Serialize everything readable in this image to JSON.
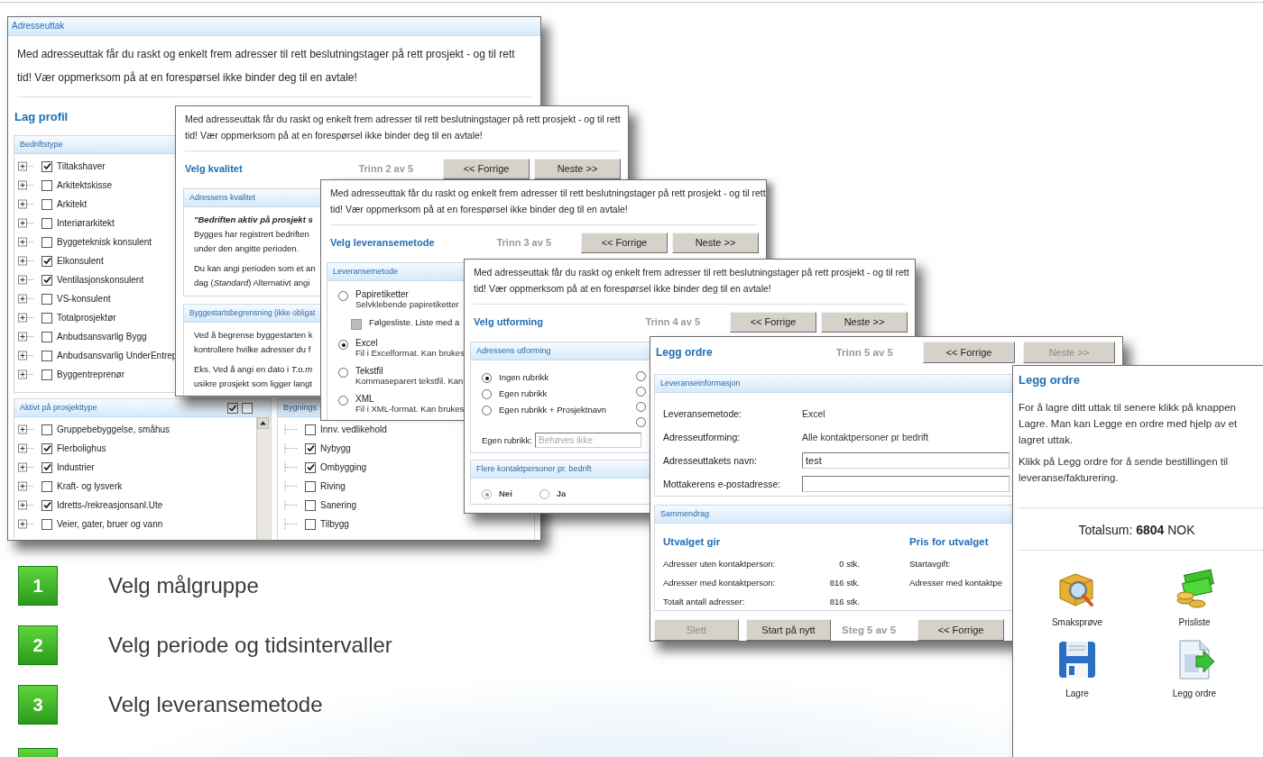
{
  "profile_window": {
    "title": "Adresseuttak",
    "intro": "Med adresseuttak får du raskt og enkelt frem adresser til rett beslutningstager på rett prosjekt - og til rett tid! Vær oppmerksom på at en forespørsel ikke binder deg til en avtale!",
    "heading": "Lag profil",
    "company_types": {
      "title": "Bedriftstype",
      "items": [
        {
          "label": "Tiltakshaver",
          "checked": true
        },
        {
          "label": "Arkitektskisse",
          "checked": false
        },
        {
          "label": "Arkitekt",
          "checked": false
        },
        {
          "label": "Interiørarkitekt",
          "checked": false
        },
        {
          "label": "Byggeteknisk konsulent",
          "checked": false
        },
        {
          "label": "Elkonsulent",
          "checked": true
        },
        {
          "label": "Ventilasjonskonsulent",
          "checked": true
        },
        {
          "label": "VS-konsulent",
          "checked": false
        },
        {
          "label": "Totalprosjektør",
          "checked": false
        },
        {
          "label": "Anbudsansvarlig Bygg",
          "checked": false
        },
        {
          "label": "Anbudsansvarlig UnderEntrep",
          "checked": false
        },
        {
          "label": "Byggentreprenør",
          "checked": false
        }
      ]
    },
    "project_types": {
      "title": "Aktivt på prosjekttype",
      "items": [
        {
          "label": "Gruppebebyggelse, småhus",
          "checked": false
        },
        {
          "label": "Flerbolighus",
          "checked": true
        },
        {
          "label": "Industrier",
          "checked": true
        },
        {
          "label": "Kraft- og lysverk",
          "checked": false
        },
        {
          "label": "Idretts-/rekreasjonsanl.Ute",
          "checked": true
        },
        {
          "label": "Veier, gater, bruer og vann",
          "checked": false
        }
      ]
    },
    "building_types": {
      "title": "Bygnings",
      "items": [
        {
          "label": "Innv. vedlikehold",
          "checked": false
        },
        {
          "label": "Nybygg",
          "checked": true
        },
        {
          "label": "Ombygging",
          "checked": true
        },
        {
          "label": "Riving",
          "checked": false
        },
        {
          "label": "Sanering",
          "checked": false
        },
        {
          "label": "Tilbygg",
          "checked": false
        }
      ]
    }
  },
  "quality_window": {
    "intro": "Med adresseuttak får du raskt og enkelt frem adresser til rett beslutningstager på rett prosjekt - og til rett tid! Vær oppmerksom på at en forespørsel ikke binder deg til en avtale!",
    "heading": "Velg kvalitet",
    "step": "Trinn 2 av 5",
    "buttons": [
      {
        "label": "<< Forrige",
        "disabled": false
      },
      {
        "label": "Neste >>",
        "disabled": false
      }
    ],
    "panels": [
      {
        "title": "Adressens kvalitet",
        "quote": "\"Bedriften aktiv på prosjekt s",
        "paragraphs": [
          [
            "Bygges har registrert bedriften",
            "under den angitte perioden."
          ],
          [
            "Du kan angi perioden som et an",
            "dag (*Standard*) Alternativt angi"
          ]
        ]
      },
      {
        "title": "Byggestartsbegrensning (ikke obligat",
        "paragraphs": [
          [
            "Ved å begrense byggestarten k",
            "kontrollere hvilke adresser du f"
          ],
          [
            "Eks. Ved å angi en dato i *T.o.m*",
            "usikre prosjekt som ligger langt"
          ]
        ]
      }
    ]
  },
  "delivery_window": {
    "intro": "Med adresseuttak får du raskt og enkelt frem adresser til rett beslutningstager på rett prosjekt - og til rett tid! Vær oppmerksom på at en forespørsel ikke binder deg til en avtale!",
    "heading": "Velg leveransemetode",
    "step": "Trinn 3 av 5",
    "buttons": [
      {
        "label": "<< Forrige",
        "disabled": false
      },
      {
        "label": "Neste >>",
        "disabled": false
      }
    ],
    "panel": {
      "title": "Leveransemetode",
      "options": [
        {
          "kind": "radio",
          "label": "Papiretiketter",
          "description": "Selvklebende papiretiketter",
          "selected": false
        },
        {
          "kind": "checkbox",
          "label": "Følgesliste. Liste med a",
          "checked": false,
          "disabled": true
        },
        {
          "kind": "radio",
          "label": "Excel",
          "description": "Fil i Excelformat. Kan brukes",
          "selected": true
        },
        {
          "kind": "radio",
          "label": "Tekstfil",
          "description": "Kommaseparert tekstfil. Kan",
          "selected": false
        },
        {
          "kind": "radio",
          "label": "XML",
          "description": "Fil i XML-format. Kan brukes",
          "selected": false
        }
      ]
    }
  },
  "format_window": {
    "intro": "Med adresseuttak får du raskt og enkelt frem adresser til rett beslutningstager på rett prosjekt - og til rett tid! Vær oppmerksom på at en forespørsel ikke binder deg til en avtale!",
    "heading": "Velg utforming",
    "step": "Trinn 4 av 5",
    "buttons": [
      {
        "label": "<< Forrige",
        "disabled": false
      },
      {
        "label": "Neste >>",
        "disabled": false
      }
    ],
    "layout_panel": {
      "title": "Adressens utforming",
      "options": [
        {
          "label": "Ingen rubrikk",
          "selected": true
        },
        {
          "label": "Egen rubrikk",
          "selected": false
        },
        {
          "label": "Egen rubrikk + Prosjektnavn",
          "selected": false
        }
      ],
      "more_options": [
        {
          "selected": false
        },
        {
          "selected": false
        },
        {
          "selected": false
        },
        {
          "selected": false
        }
      ],
      "field": {
        "label": "Egen rubrikk:",
        "placeholder": "Behøves ikke"
      }
    },
    "contacts_panel": {
      "title": "Flere kontaktpersoner pr. bedrift",
      "options": [
        {
          "label": "Nei",
          "selected": true,
          "disabled": true
        },
        {
          "label": "Ja",
          "selected": false,
          "disabled": true
        }
      ]
    }
  },
  "order_window": {
    "heading": "Legg ordre",
    "step": "Trinn 5 av 5",
    "buttons": [
      {
        "label": "<< Forrige",
        "disabled": false
      },
      {
        "label": "Neste >>",
        "disabled": true
      }
    ],
    "delivery_info": {
      "title": "Leveranseinformasjon",
      "rows": [
        {
          "kind": "text",
          "label": "Leveransemetode:",
          "value": "Excel"
        },
        {
          "kind": "text",
          "label": "Adresseutforming:",
          "value": "Alle kontaktpersoner pr bedrift"
        },
        {
          "kind": "input",
          "label": "Adresseuttakets navn:",
          "value": "test"
        },
        {
          "kind": "input",
          "label": "Mottakerens e-postadresse:"
        }
      ]
    },
    "summary": {
      "title": "Sammendrag",
      "result_heading": "Utvalget gir",
      "result_rows": [
        {
          "label": "Adresser uten kontaktperson:",
          "value": "0 stk."
        },
        {
          "label": "Adresser med kontaktperson:",
          "value": "816 stk."
        },
        {
          "label": "Totalt antall adresser:",
          "value": "816 stk."
        }
      ],
      "price_heading": "Pris for utvalget",
      "price_rows": [
        {
          "label": "Startavgift:"
        },
        {
          "label": "Adresser med kontaktpe"
        }
      ]
    },
    "footer": {
      "buttons": [
        {
          "label": "Slett",
          "disabled": true
        },
        {
          "label": "Start på nytt",
          "disabled": false
        }
      ],
      "step": "Steg 5 av 5",
      "back_button": {
        "label": "<< Forrige",
        "disabled": false
      }
    }
  },
  "side_panel": {
    "heading": "Legg ordre",
    "paragraphs": [
      "For å lagre ditt uttak til senere klikk på knappen Lagre. Man kan Legge en ordre med hjelp av et lagret uttak.",
      "Klikk på Legg ordre for å sende bestillingen til leveranse/fakturering."
    ],
    "total": "Totalsum: **6804** NOK",
    "actions": [
      {
        "kind": "sample",
        "label": "Smaksprøve"
      },
      {
        "kind": "pricelist",
        "label": "Prisliste"
      },
      {
        "kind": "save",
        "label": "Lagre"
      },
      {
        "kind": "order",
        "label": "Legg ordre"
      }
    ]
  },
  "steps": [
    {
      "number": "1",
      "label": "Velg målgruppe"
    },
    {
      "number": "2",
      "label": "Velg periode og tidsintervaller"
    },
    {
      "number": "3",
      "label": "Velg leveransemetode"
    }
  ]
}
